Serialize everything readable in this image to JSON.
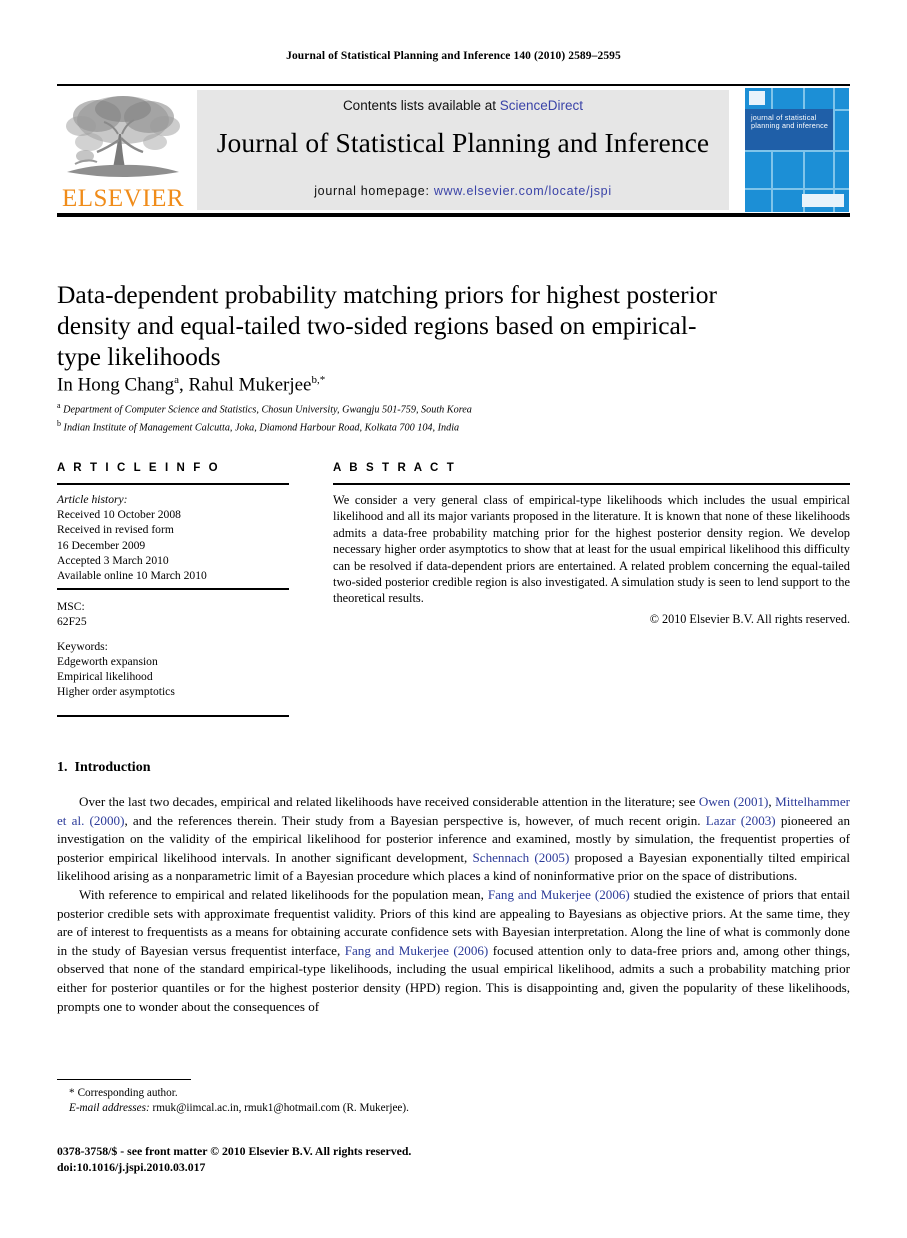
{
  "running_head": "Journal of Statistical Planning and Inference 140 (2010) 2589–2595",
  "masthead": {
    "contents_prefix": "Contents lists available at ",
    "sciencedirect_label": "ScienceDirect",
    "journal_title": "Journal of Statistical Planning and Inference",
    "homepage_prefix": "journal homepage: ",
    "homepage_url": "www.elsevier.com/locate/jspi",
    "publisher_wordmark": "ELSEVIER",
    "cover_title": "journal of statistical planning and inference",
    "link_color": "#3A43A8",
    "publisher_color": "#F08C1A",
    "cover_color": "#1C8FD6"
  },
  "article": {
    "title": "Data-dependent probability matching priors for highest posterior density and equal-tailed two-sided regions based on empirical-type likelihoods",
    "authors": "In Hong Chang a, Rahul Mukerjee b,*",
    "author_1_name": "In Hong Chang",
    "author_1_marker": "a",
    "author_2_name": "Rahul Mukerjee",
    "author_2_marker": "b,*",
    "affiliation_a_marker": "a",
    "affiliation_a": "Department of Computer Science and Statistics, Chosun University, Gwangju 501-759, South Korea",
    "affiliation_b_marker": "b",
    "affiliation_b": "Indian Institute of Management Calcutta, Joka, Diamond Harbour Road, Kolkata 700 104, India"
  },
  "article_info": {
    "heading": "A R T I C L E   I N F O",
    "history_label": "Article history:",
    "history_lines": [
      "Received 10 October 2008",
      "Received in revised form",
      "16 December 2009",
      "Accepted 3 March 2010",
      "Available online 10 March 2010"
    ],
    "msc_label": "MSC:",
    "msc_value": "62F25",
    "keywords_label": "Keywords:",
    "keywords": [
      "Edgeworth expansion",
      "Empirical likelihood",
      "Higher order asymptotics"
    ]
  },
  "abstract": {
    "heading": "A B S T R A C T",
    "text": "We consider a very general class of empirical-type likelihoods which includes the usual empirical likelihood and all its major variants proposed in the literature. It is known that none of these likelihoods admits a data-free probability matching prior for the highest posterior density region. We develop necessary higher order asymptotics to show that at least for the usual empirical likelihood this difficulty can be resolved if data-dependent priors are entertained. A related problem concerning the equal-tailed two-sided posterior credible region is also investigated. A simulation study is seen to lend support to the theoretical results.",
    "copyright": "© 2010 Elsevier B.V. All rights reserved."
  },
  "introduction": {
    "number": "1.",
    "heading": "Introduction",
    "paragraph_1": {
      "part_1": "Over the last two decades, empirical and related likelihoods have received considerable attention in the literature; see ",
      "cite_1": "Owen (2001)",
      "part_2": ", ",
      "cite_2": "Mittelhammer et al. (2000)",
      "part_3": ", and the references therein. Their study from a Bayesian perspective is, however, of much recent origin. ",
      "cite_3": "Lazar (2003)",
      "part_4": " pioneered an investigation on the validity of the empirical likelihood for posterior inference and examined, mostly by simulation, the frequentist properties of posterior empirical likelihood intervals. In another significant development, ",
      "cite_4": "Schennach (2005)",
      "part_5": " proposed a Bayesian exponentially tilted empirical likelihood arising as a nonparametric limit of a Bayesian procedure which places a kind of noninformative prior on the space of distributions."
    },
    "paragraph_2": {
      "part_1": "With reference to empirical and related likelihoods for the population mean, ",
      "cite_1": "Fang and Mukerjee (2006)",
      "part_2": " studied the existence of priors that entail posterior credible sets with approximate frequentist validity. Priors of this kind are appealing to Bayesians as objective priors. At the same time, they are of interest to frequentists as a means for obtaining accurate confidence sets with Bayesian interpretation. Along the line of what is commonly done in the study of Bayesian versus frequentist interface, ",
      "cite_2": "Fang and Mukerjee (2006)",
      "part_3": " focused attention only to data-free priors and, among other things, observed that none of the standard empirical-type likelihoods, including the usual empirical likelihood, admits a such a probability matching prior either for posterior quantiles or for the highest posterior density (HPD) region. This is disappointing and, given the popularity of these likelihoods, prompts one to wonder about the consequences of"
    }
  },
  "footer": {
    "corresponding_marker": "*",
    "corresponding_label": "Corresponding author.",
    "email_label": "E-mail addresses:",
    "email_value": " rmuk@iimcal.ac.in, rmuk1@hotmail.com (R. Mukerjee).",
    "issn_line": "0378-3758/$ - see front matter © 2010 Elsevier B.V. All rights reserved.",
    "doi_line": "doi:10.1016/j.jspi.2010.03.017"
  }
}
